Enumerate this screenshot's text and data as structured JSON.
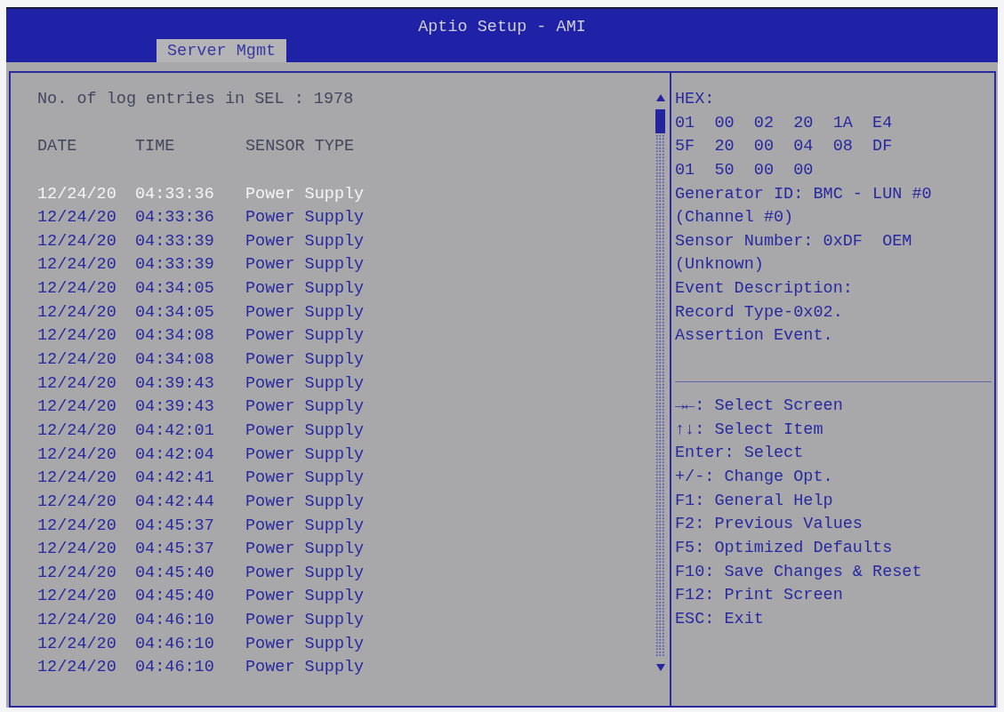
{
  "window": {
    "title": "Aptio Setup - AMI"
  },
  "tabs": [
    {
      "label": "Server Mgmt",
      "selected": true
    }
  ],
  "log": {
    "summary": "No. of log entries in SEL : 1978",
    "columns": [
      "DATE",
      "TIME",
      "SENSOR TYPE"
    ],
    "rows": [
      {
        "date": "12/24/20",
        "time": "04:33:36",
        "sensor_type": "Power Supply",
        "selected": true
      },
      {
        "date": "12/24/20",
        "time": "04:33:36",
        "sensor_type": "Power Supply",
        "selected": false
      },
      {
        "date": "12/24/20",
        "time": "04:33:39",
        "sensor_type": "Power Supply",
        "selected": false
      },
      {
        "date": "12/24/20",
        "time": "04:33:39",
        "sensor_type": "Power Supply",
        "selected": false
      },
      {
        "date": "12/24/20",
        "time": "04:34:05",
        "sensor_type": "Power Supply",
        "selected": false
      },
      {
        "date": "12/24/20",
        "time": "04:34:05",
        "sensor_type": "Power Supply",
        "selected": false
      },
      {
        "date": "12/24/20",
        "time": "04:34:08",
        "sensor_type": "Power Supply",
        "selected": false
      },
      {
        "date": "12/24/20",
        "time": "04:34:08",
        "sensor_type": "Power Supply",
        "selected": false
      },
      {
        "date": "12/24/20",
        "time": "04:39:43",
        "sensor_type": "Power Supply",
        "selected": false
      },
      {
        "date": "12/24/20",
        "time": "04:39:43",
        "sensor_type": "Power Supply",
        "selected": false
      },
      {
        "date": "12/24/20",
        "time": "04:42:01",
        "sensor_type": "Power Supply",
        "selected": false
      },
      {
        "date": "12/24/20",
        "time": "04:42:04",
        "sensor_type": "Power Supply",
        "selected": false
      },
      {
        "date": "12/24/20",
        "time": "04:42:41",
        "sensor_type": "Power Supply",
        "selected": false
      },
      {
        "date": "12/24/20",
        "time": "04:42:44",
        "sensor_type": "Power Supply",
        "selected": false
      },
      {
        "date": "12/24/20",
        "time": "04:45:37",
        "sensor_type": "Power Supply",
        "selected": false
      },
      {
        "date": "12/24/20",
        "time": "04:45:37",
        "sensor_type": "Power Supply",
        "selected": false
      },
      {
        "date": "12/24/20",
        "time": "04:45:40",
        "sensor_type": "Power Supply",
        "selected": false
      },
      {
        "date": "12/24/20",
        "time": "04:45:40",
        "sensor_type": "Power Supply",
        "selected": false
      },
      {
        "date": "12/24/20",
        "time": "04:46:10",
        "sensor_type": "Power Supply",
        "selected": false
      },
      {
        "date": "12/24/20",
        "time": "04:46:10",
        "sensor_type": "Power Supply",
        "selected": false
      },
      {
        "date": "12/24/20",
        "time": "04:46:10",
        "sensor_type": "Power Supply",
        "selected": false
      }
    ]
  },
  "details": {
    "lines": [
      "HEX:",
      "01  00  02  20  1A  E4",
      "5F  20  00  04  08  DF",
      "01  50  00  00",
      "Generator ID: BMC - LUN #0",
      "(Channel #0)",
      "Sensor Number: 0xDF  OEM",
      "(Unknown)",
      "Event Description:",
      "Record Type-0x02.",
      "Assertion Event."
    ]
  },
  "help": {
    "lines": [
      "→←: Select Screen",
      "↑↓: Select Item",
      "Enter: Select",
      "+/-: Change Opt.",
      "F1: General Help",
      "F2: Previous Values",
      "F5: Optimized Defaults",
      "F10: Save Changes & Reset",
      "F12: Print Screen",
      "ESC: Exit"
    ]
  }
}
